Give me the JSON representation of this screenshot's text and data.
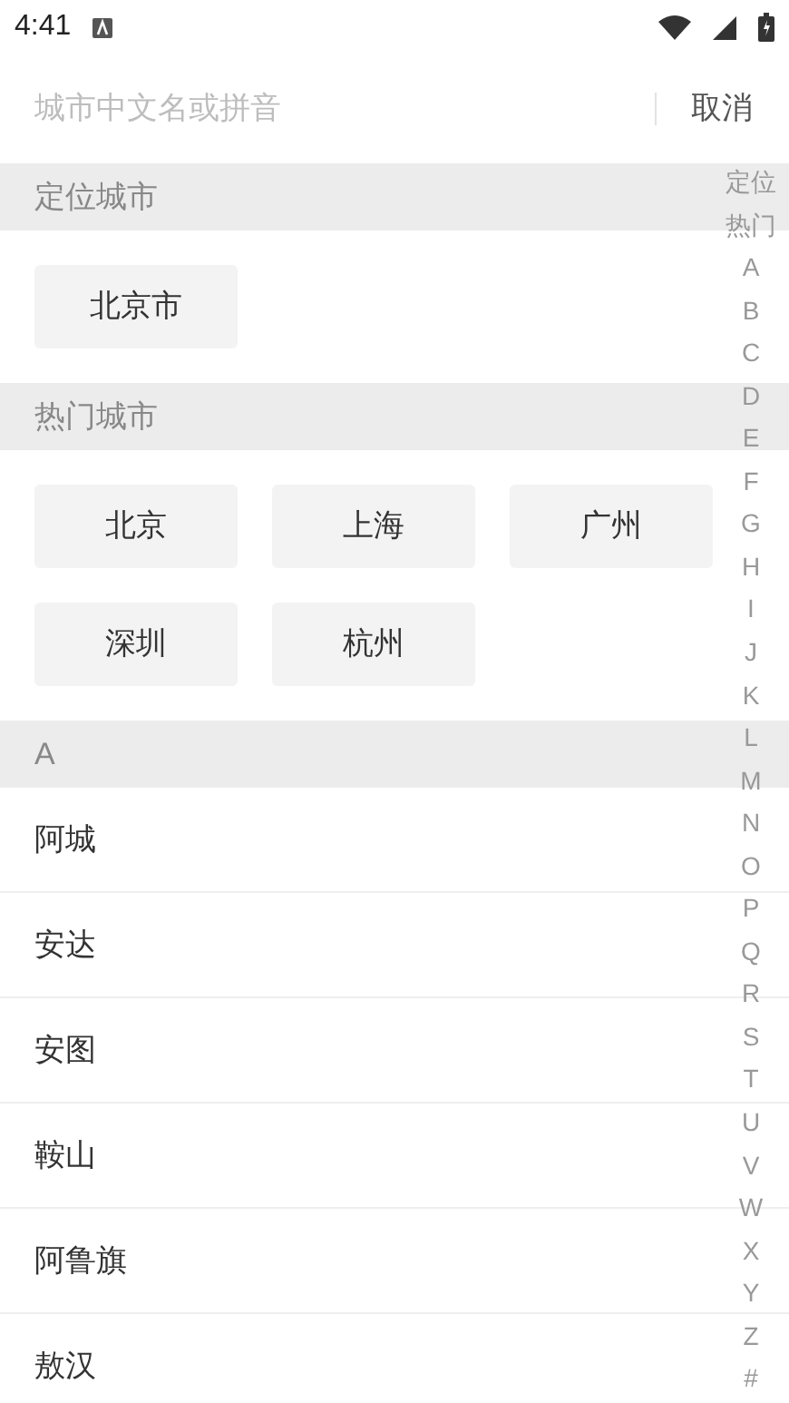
{
  "status_bar": {
    "time": "4:41"
  },
  "search": {
    "placeholder": "城市中文名或拼音",
    "cancel": "取消"
  },
  "sections": [
    {
      "kind": "buttons",
      "title": "定位城市",
      "items": [
        "北京市"
      ]
    },
    {
      "kind": "buttons",
      "title": "热门城市",
      "items": [
        "北京",
        "上海",
        "广州",
        "深圳",
        "杭州"
      ]
    },
    {
      "kind": "list",
      "title": "A",
      "items": [
        "阿城",
        "安达",
        "安图",
        "鞍山",
        "阿鲁旗",
        "敖汉"
      ]
    }
  ],
  "index_bar": [
    "定位",
    "热门",
    "A",
    "B",
    "C",
    "D",
    "E",
    "F",
    "G",
    "H",
    "I",
    "J",
    "K",
    "L",
    "M",
    "N",
    "O",
    "P",
    "Q",
    "R",
    "S",
    "T",
    "U",
    "V",
    "W",
    "X",
    "Y",
    "Z",
    "#"
  ]
}
